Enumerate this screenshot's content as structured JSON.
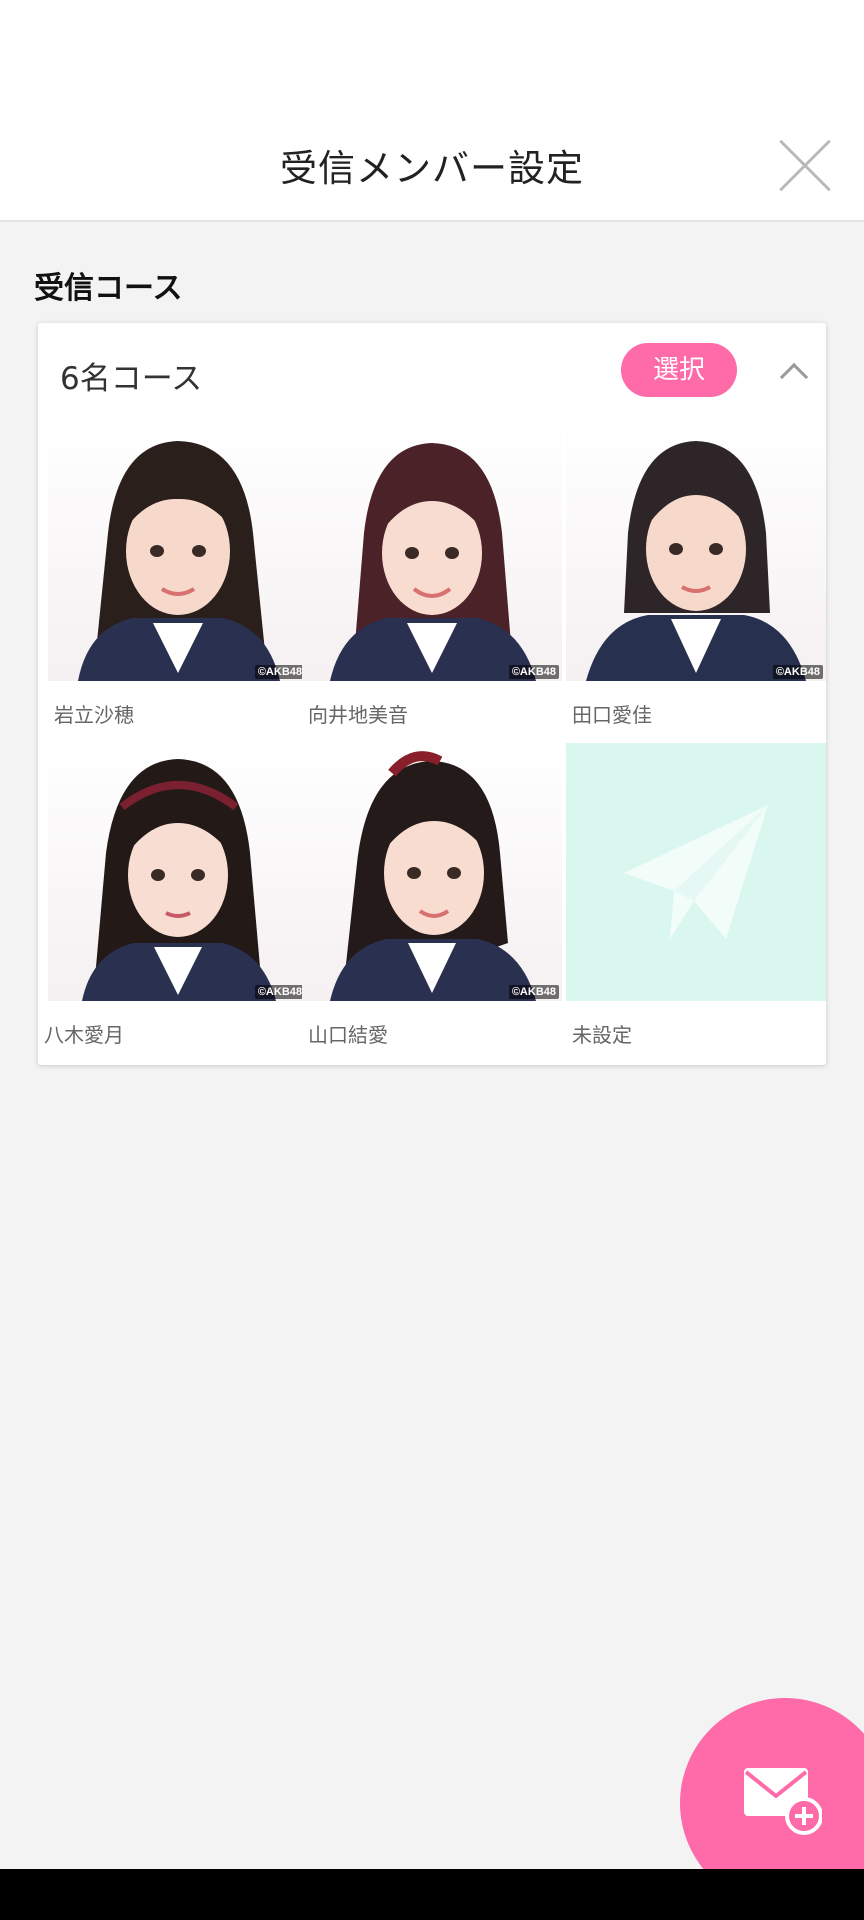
{
  "header": {
    "title": "受信メンバー設定",
    "close_icon": "close-icon"
  },
  "section": {
    "title": "受信コース"
  },
  "course": {
    "name": "6名コース",
    "select_label": "選択",
    "collapse_icon": "chevron-up-icon",
    "members": [
      {
        "name": "岩立沙穂",
        "copyright": "©AKB48",
        "hair": "#2b1f1c",
        "bg": "#ffffff"
      },
      {
        "name": "向井地美音",
        "copyright": "©AKB48",
        "hair": "#4a2228",
        "bg": "#ffffff"
      },
      {
        "name": "田口愛佳",
        "copyright": "©AKB48",
        "hair": "#2d2527",
        "bg": "#ffffff"
      },
      {
        "name": "八木愛月",
        "copyright": "©AKB48",
        "hair": "#231a18",
        "bg": "#ffffff"
      },
      {
        "name": "山口結愛",
        "copyright": "©AKB48",
        "hair": "#241a19",
        "bg": "#ffffff"
      },
      {
        "name": "未設定",
        "placeholder_icon": "paper-plane-icon",
        "bg": "#d9f6ef"
      }
    ]
  },
  "fab": {
    "icon": "mail-add-icon",
    "color": "#ff6aa9"
  },
  "colors": {
    "accent": "#ff6aa9",
    "background": "#f3f3f3",
    "placeholder": "#d9f6ef"
  }
}
